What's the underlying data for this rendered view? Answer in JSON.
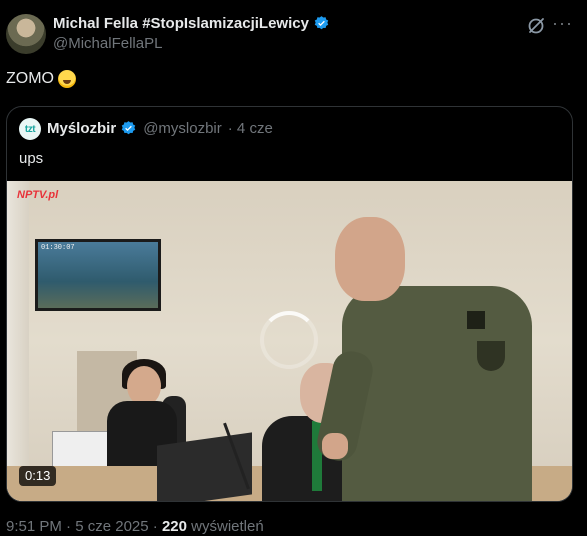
{
  "author": {
    "name": "Michal Fella #StopIslamizacjiLewicy",
    "handle": "@MichalFellaPL",
    "verified": true,
    "avatar_icon": "profile-photo"
  },
  "tweet": {
    "text": "ZOMO",
    "emoji": "rolling-on-floor-laughing-emoji"
  },
  "quote": {
    "avatar_text": "tzt",
    "name": "Myślozbir",
    "verified": true,
    "handle": "@myslozbir",
    "time": "· 4 cze",
    "text": "ups",
    "video": {
      "duration": "0:13",
      "channel_logo": "NPTV.pl",
      "screen_time": "01:30:07"
    }
  },
  "footer": {
    "time": "9:51 PM",
    "sep1": "·",
    "date": "5 cze 2025",
    "sep2": "·",
    "views_count": "220",
    "views_label": "wyświetleń"
  },
  "colors": {
    "verified": "#1d9bf0",
    "secondary_text": "#71767b",
    "primary_text": "#e7e9ea",
    "border": "#2f3336",
    "background": "#000000"
  }
}
